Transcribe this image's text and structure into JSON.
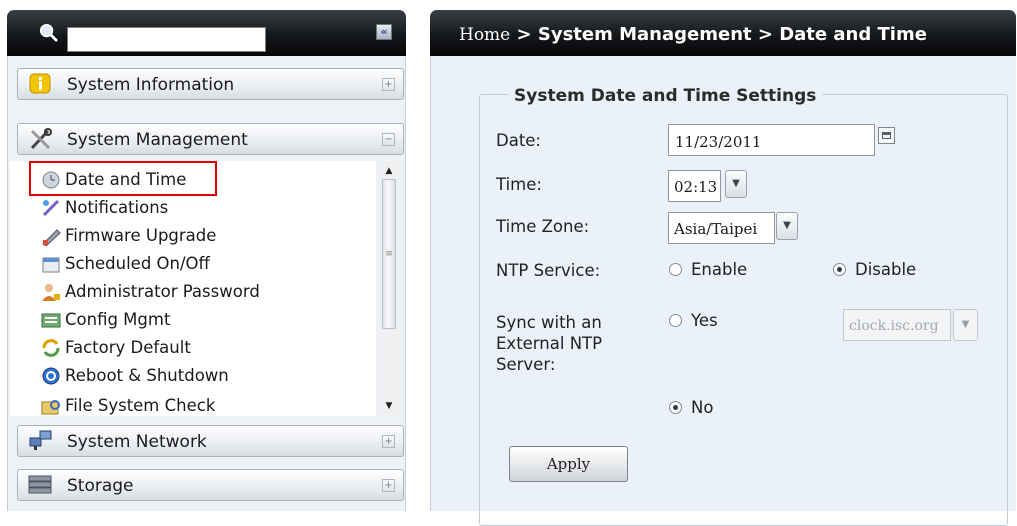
{
  "search": {
    "value": "",
    "placeholder": ""
  },
  "collapse_label": "«",
  "breadcrumb": {
    "home": "Home",
    "rest": " > System Management > Date and Time"
  },
  "sidebar": {
    "sections": [
      {
        "label": "System Information",
        "toggle": "+"
      },
      {
        "label": "System Management",
        "toggle": "−"
      },
      {
        "label": "System Network",
        "toggle": "+"
      },
      {
        "label": "Storage",
        "toggle": "+"
      }
    ],
    "items": [
      {
        "label": "Date and Time"
      },
      {
        "label": "Notifications"
      },
      {
        "label": "Firmware Upgrade"
      },
      {
        "label": "Scheduled On/Off"
      },
      {
        "label": "Administrator Password"
      },
      {
        "label": "Config Mgmt"
      },
      {
        "label": "Factory Default"
      },
      {
        "label": "Reboot & Shutdown"
      },
      {
        "label": "File System Check"
      }
    ]
  },
  "form": {
    "legend": "System Date and Time Settings",
    "date_label": "Date:",
    "date_value": "11/23/2011",
    "time_label": "Time:",
    "time_value": "02:13",
    "tz_label": "Time Zone:",
    "tz_value": "Asia/Taipei",
    "ntp_label": "NTP Service:",
    "ntp_enable": "Enable",
    "ntp_disable": "Disable",
    "sync_label_1": "Sync with an",
    "sync_label_2": "External NTP",
    "sync_label_3": "Server:",
    "sync_yes": "Yes",
    "sync_no": "No",
    "ntp_server": "clock.isc.org",
    "apply_label": "Apply"
  }
}
